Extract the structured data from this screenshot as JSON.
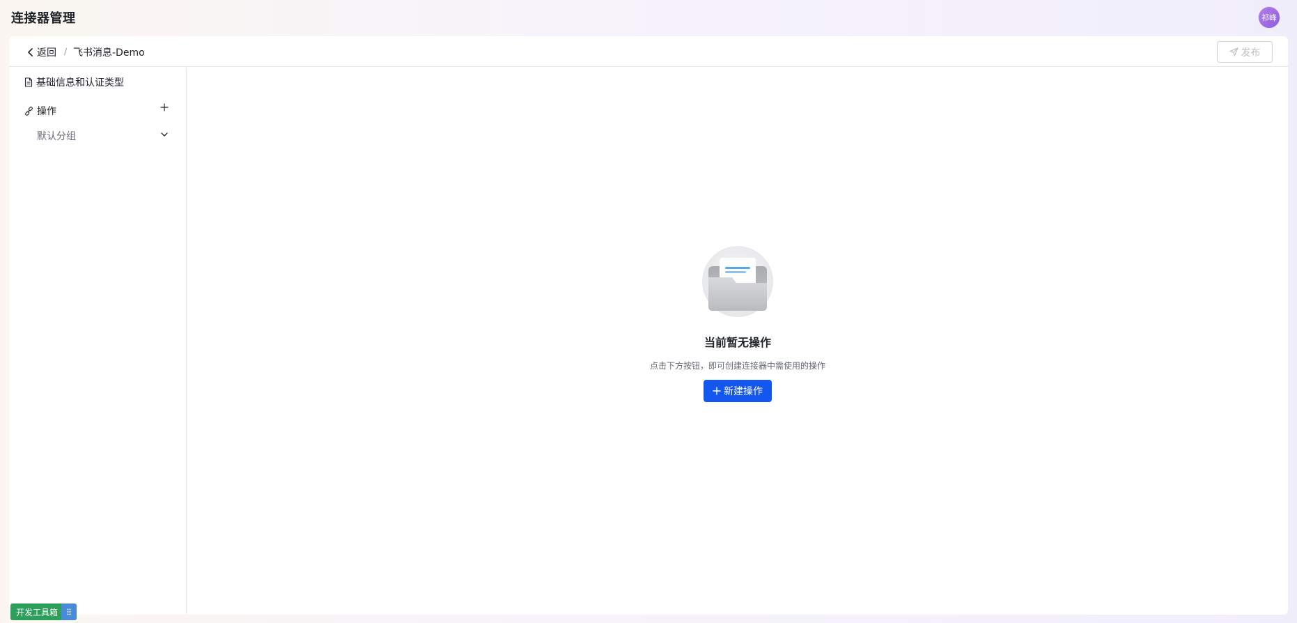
{
  "app": {
    "title": "连接器管理",
    "avatar_text": "祁峰"
  },
  "header": {
    "back_label": "返回",
    "separator": "/",
    "breadcrumb_current": "飞书消息-Demo",
    "publish_label": "发布"
  },
  "sidebar": {
    "basic_info_label": "基础信息和认证类型",
    "operations_label": "操作",
    "group_label": "默认分组"
  },
  "empty_state": {
    "title": "当前暂无操作",
    "description": "点击下方按钮，即可创建连接器中需使用的操作",
    "button_label": "新建操作"
  },
  "devtools": {
    "label": "开发工具箱"
  },
  "colors": {
    "primary": "#1456f0",
    "devtools_bg": "#2e9e5b",
    "devtools_grip": "#4a8bd8"
  }
}
